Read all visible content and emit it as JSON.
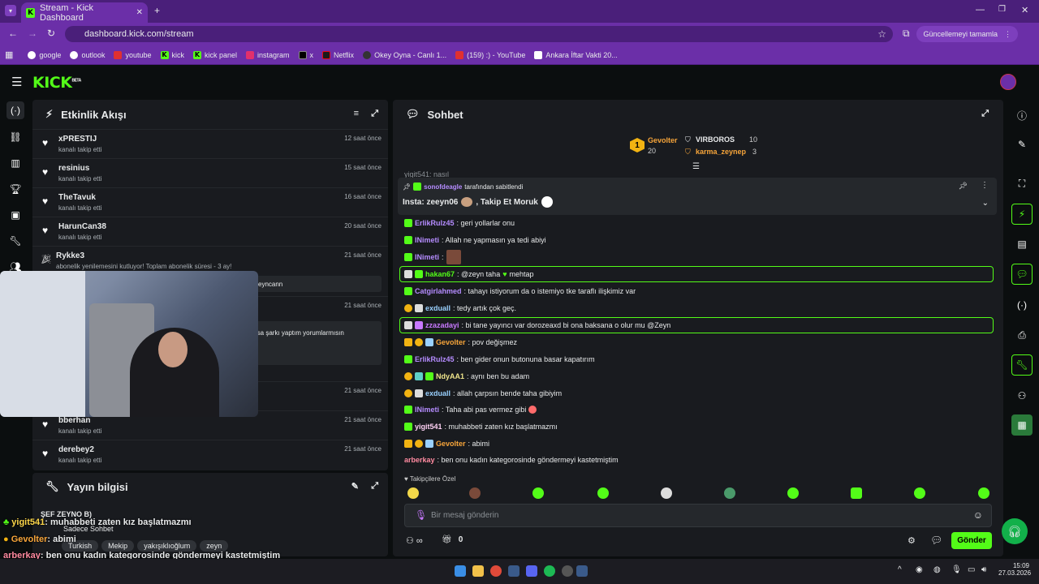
{
  "browser": {
    "tab_title": "Stream - Kick Dashboard",
    "url": "dashboard.kick.com/stream",
    "update_button": "Güncellemeyi tamamla",
    "profile_letter": "Z",
    "bookmarks": [
      "google",
      "outlook",
      "youtube",
      "kick",
      "kick panel",
      "instagram",
      "x",
      "Netflix",
      "Okey Oyna - Canlı 1...",
      "(159) :) - YouTube",
      "Ankara İftar Vakti 20..."
    ]
  },
  "header": {
    "logo": "KICK",
    "logo_sup": "BETA"
  },
  "activity": {
    "title": "Etkinlik Akışı",
    "events": [
      {
        "name": "xPRESTIJ",
        "sub": "kanalı takip etti",
        "time": "12 saat önce"
      },
      {
        "name": "resinius",
        "sub": "kanalı takip etti",
        "time": "15 saat önce"
      },
      {
        "name": "TheTavuk",
        "sub": "kanalı takip etti",
        "time": "16 saat önce"
      },
      {
        "name": "HarunCan38",
        "sub": "kanalı takip etti",
        "time": "20 saat önce"
      },
      {
        "name": "Rykke3",
        "sub": "abonelik yenilemesini kutluyor! Toplam abonelik süresi - 3 ay!",
        "time": "21 saat önce",
        "quote": "zeyncann"
      },
      {
        "name": "",
        "sub": "",
        "time": "21 saat önce",
        "quote": "rsa şarkı yaptım yorumlarmısın"
      },
      {
        "name": "",
        "sub": "",
        "time": "21 saat önce"
      },
      {
        "name": "bberhan",
        "sub": "kanalı takip etti",
        "time": "21 saat önce"
      },
      {
        "name": "derebey2",
        "sub": "kanalı takip etti",
        "time": "21 saat önce"
      }
    ]
  },
  "stream_info": {
    "title": "Yayın bilgisi",
    "stream_title": "ŞEF ZEYNO B)",
    "chat_mode": "Sadece Sohbet",
    "tags": [
      "Turkish",
      "Mekip",
      "yakışıklıoğlum",
      "zeyn"
    ]
  },
  "chat": {
    "title": "Sohbet",
    "leaders": [
      {
        "rank": "1",
        "name": "Gevolter",
        "count": "20"
      },
      {
        "name": "VIRBOROS",
        "count": "10"
      },
      {
        "name": "karma_zeynep",
        "count": "3"
      }
    ],
    "partial_line": "yigit541: nasıl",
    "pinned": {
      "by": "sonofdeagle",
      "by_suffix": "tarafından sabitlendi",
      "text1": "Insta: zeeyn06",
      "text2": ", Takip Et Moruk"
    },
    "messages": [
      {
        "user": "ErlikRulz45",
        "color": "#b58cff",
        "text": ": geri yollarlar onu"
      },
      {
        "user": "INimeti",
        "color": "#b58cff",
        "text": ": Allah ne yapmasın ya tedi abiyi"
      },
      {
        "user": "INimeti",
        "color": "#b58cff",
        "text": ":"
      },
      {
        "user": "hakan67",
        "color": "#53fc18",
        "text": ": @zeyn taha",
        "text2": "mehtap"
      },
      {
        "user": "Catgirlahmed",
        "color": "#b58cff",
        "text": ": tahayı istiyorum da o istemiyo tke taraflı ilişkimiz var"
      },
      {
        "user": "exduall",
        "color": "#9ad1ff",
        "text": ": tedy artık çok geç."
      },
      {
        "user": "zzazadayi",
        "color": "#c879ff",
        "text": ": bi tane yayıncı var dorozeaxd bi ona baksana o olur mu @Zeyn"
      },
      {
        "user": "Gevolter",
        "color": "#f7a53a",
        "text": ": pov değişmez"
      },
      {
        "user": "ErlikRulz45",
        "color": "#b58cff",
        "text": ": ben gider onun butonuna basar kapatırım"
      },
      {
        "user": "NdyAA1",
        "color": "#f0e68c",
        "text": ": aynı ben bu adam"
      },
      {
        "user": "exduall",
        "color": "#9ad1ff",
        "text": ": allah çarpsın bende taha gibiyim"
      },
      {
        "user": "INimeti",
        "color": "#b58cff",
        "text": ": Taha abi pas vermez gibi"
      },
      {
        "user": "yigit541",
        "color": "#ffd2f5",
        "text": ": muhabbeti zaten kız başlatmazmı"
      },
      {
        "user": "Gevolter",
        "color": "#f7a53a",
        "text": ": abimi"
      },
      {
        "user": "arberkay",
        "color": "#ff8aa0",
        "text": ": ben onu kadın kategorosinde göndermeyi kastetmiştim"
      }
    ],
    "followers_only": "Takipçilere Özel",
    "input_placeholder": "Bir mesaj gönderin",
    "points": "0",
    "send": "Gönder"
  },
  "overlay_chat": [
    {
      "user": "yigit541",
      "text": ": muhabbeti zaten kız başlatmazmı"
    },
    {
      "user": "Gevolter",
      "text": ": abimi"
    },
    {
      "user": "arberkay",
      "text": ": ben onu kadın kategorosinde göndermeyi kastetmiştim"
    }
  ],
  "taskbar": {
    "time": "15:09",
    "date": "27.03.2026"
  }
}
